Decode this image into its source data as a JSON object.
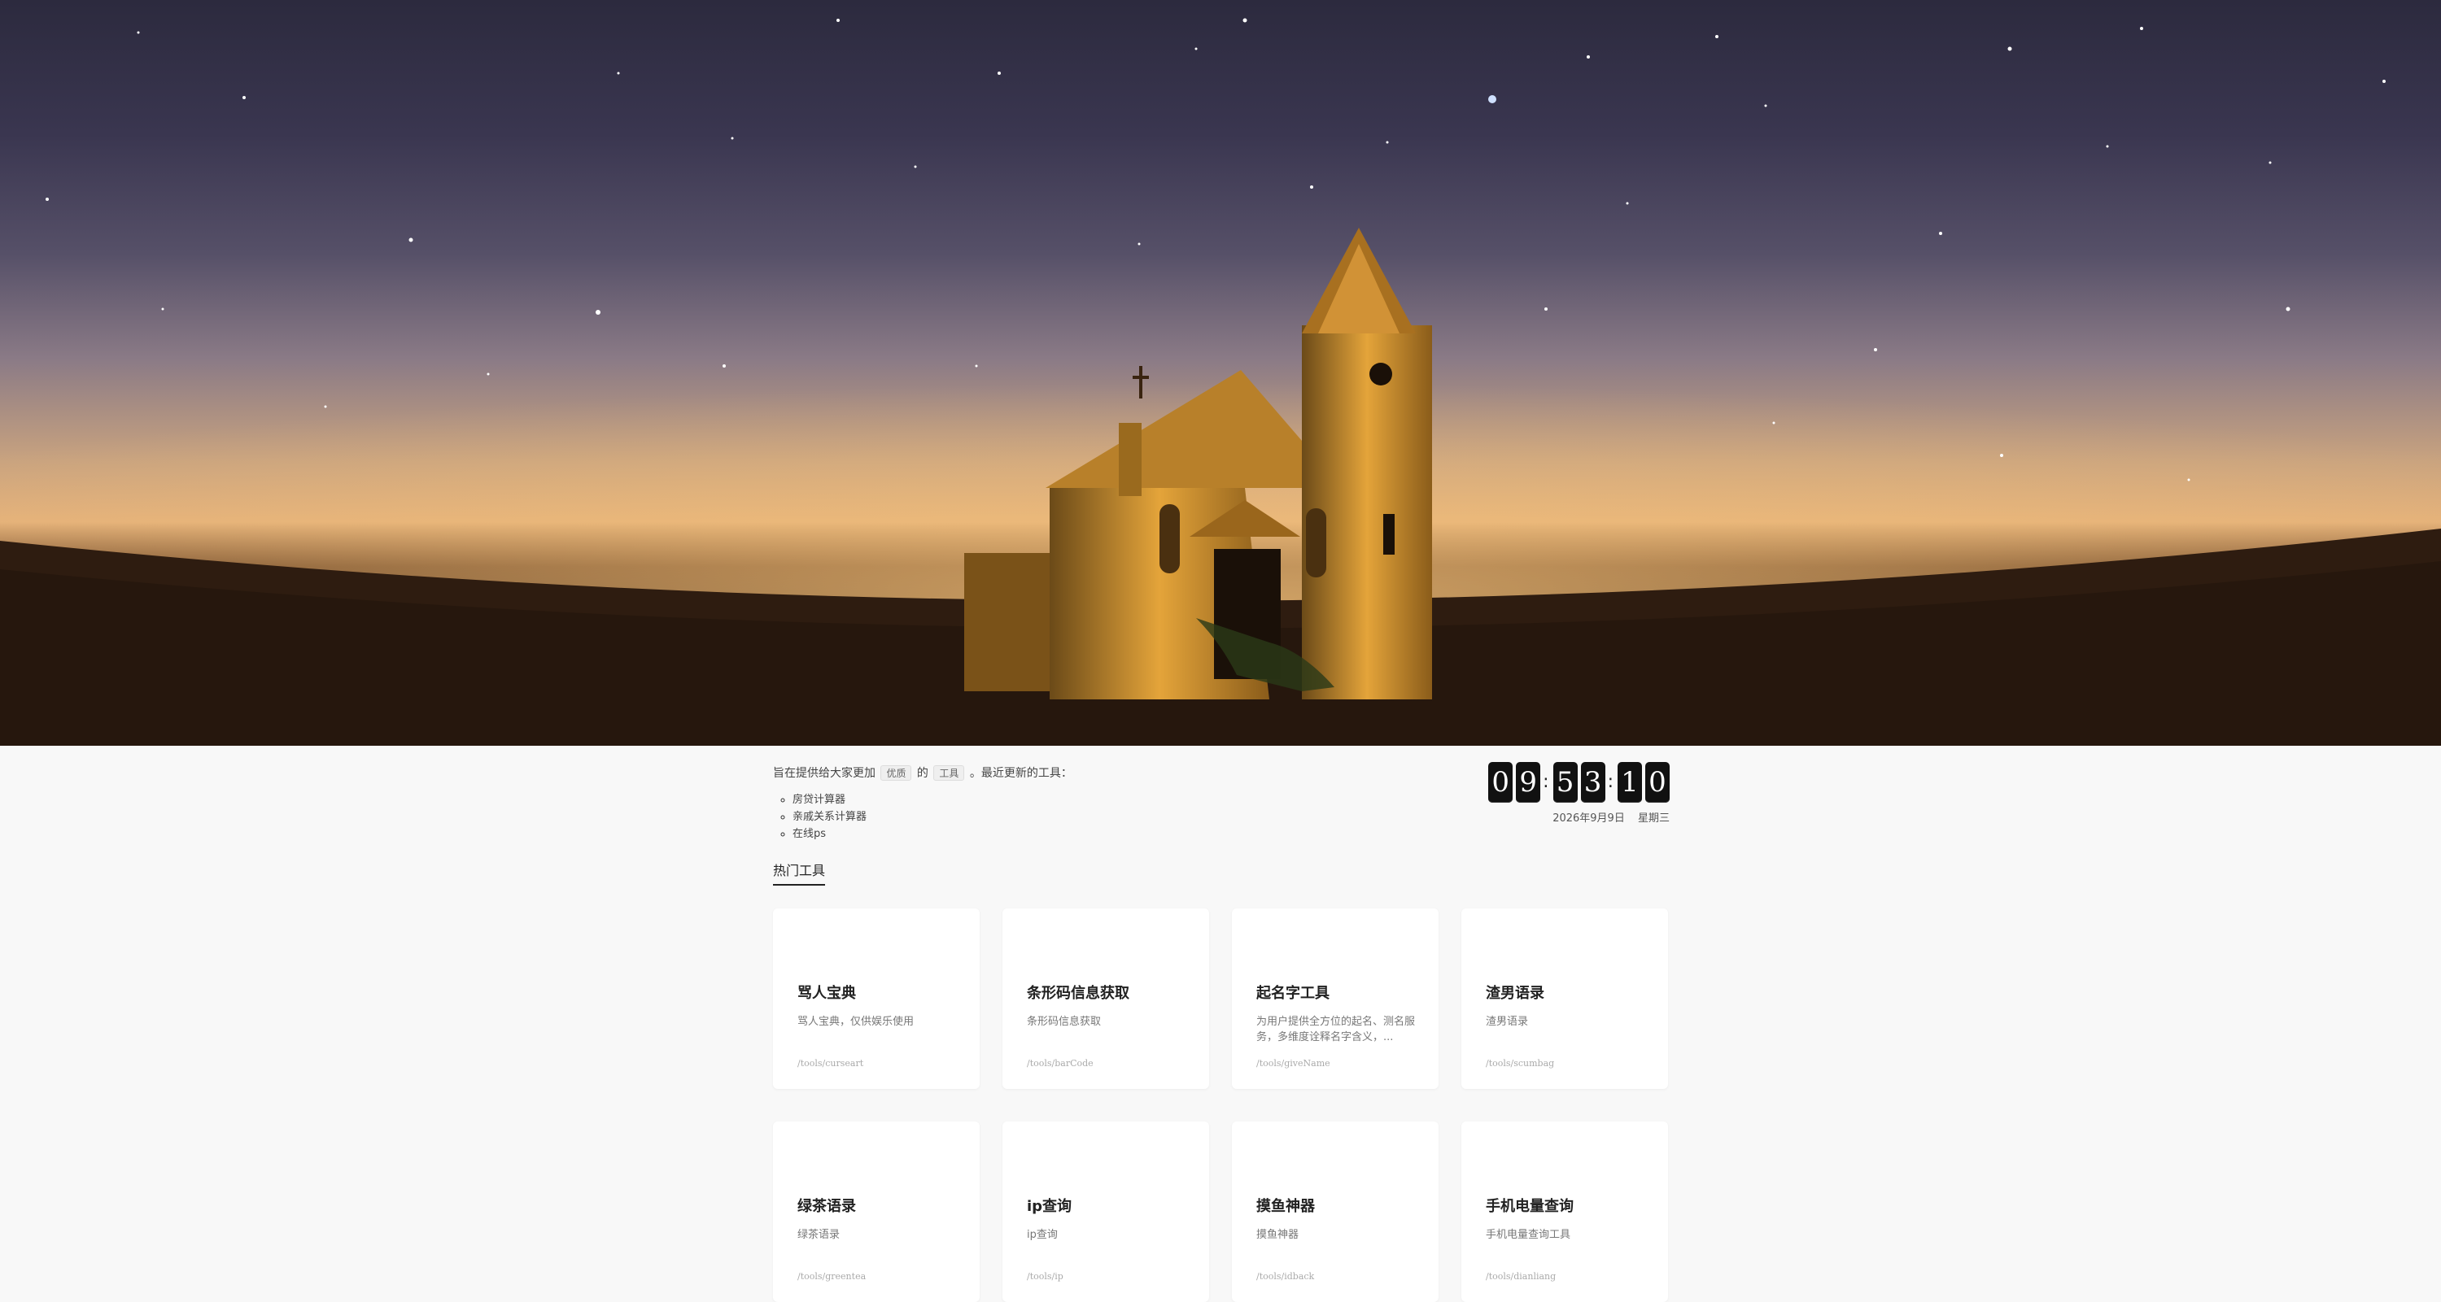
{
  "intro": {
    "text_before": "旨在提供给大家更加",
    "tag_quality": "优质",
    "text_of": "的",
    "tag_tools": "工具",
    "text_after": "。最近更新的工具："
  },
  "recent_tools": [
    "房贷计算器",
    "亲戚关系计算器",
    "在线ps"
  ],
  "hot_heading": "热门工具",
  "clock": {
    "digits": [
      "0",
      "9",
      "5",
      "3",
      "1",
      "0"
    ],
    "separator": ":",
    "date": "2026年9月9日",
    "weekday": "星期三"
  },
  "tools": [
    {
      "title": "骂人宝典",
      "desc": "骂人宝典，仅供娱乐使用",
      "path": "/tools/curseart"
    },
    {
      "title": "条形码信息获取",
      "desc": "条形码信息获取",
      "path": "/tools/barCode"
    },
    {
      "title": "起名字工具",
      "desc": "为用户提供全方位的起名、测名服务，多维度诠释名字含义，...",
      "path": "/tools/giveName"
    },
    {
      "title": "渣男语录",
      "desc": "渣男语录",
      "path": "/tools/scumbag"
    },
    {
      "title": "绿茶语录",
      "desc": "绿茶语录",
      "path": "/tools/greentea"
    },
    {
      "title": "ip查询",
      "desc": "ip查询",
      "path": "/tools/ip"
    },
    {
      "title": "摸鱼神器",
      "desc": "摸鱼神器",
      "path": "/tools/idback"
    },
    {
      "title": "手机电量查询",
      "desc": "手机电量查询工具",
      "path": "/tools/dianliang"
    }
  ]
}
